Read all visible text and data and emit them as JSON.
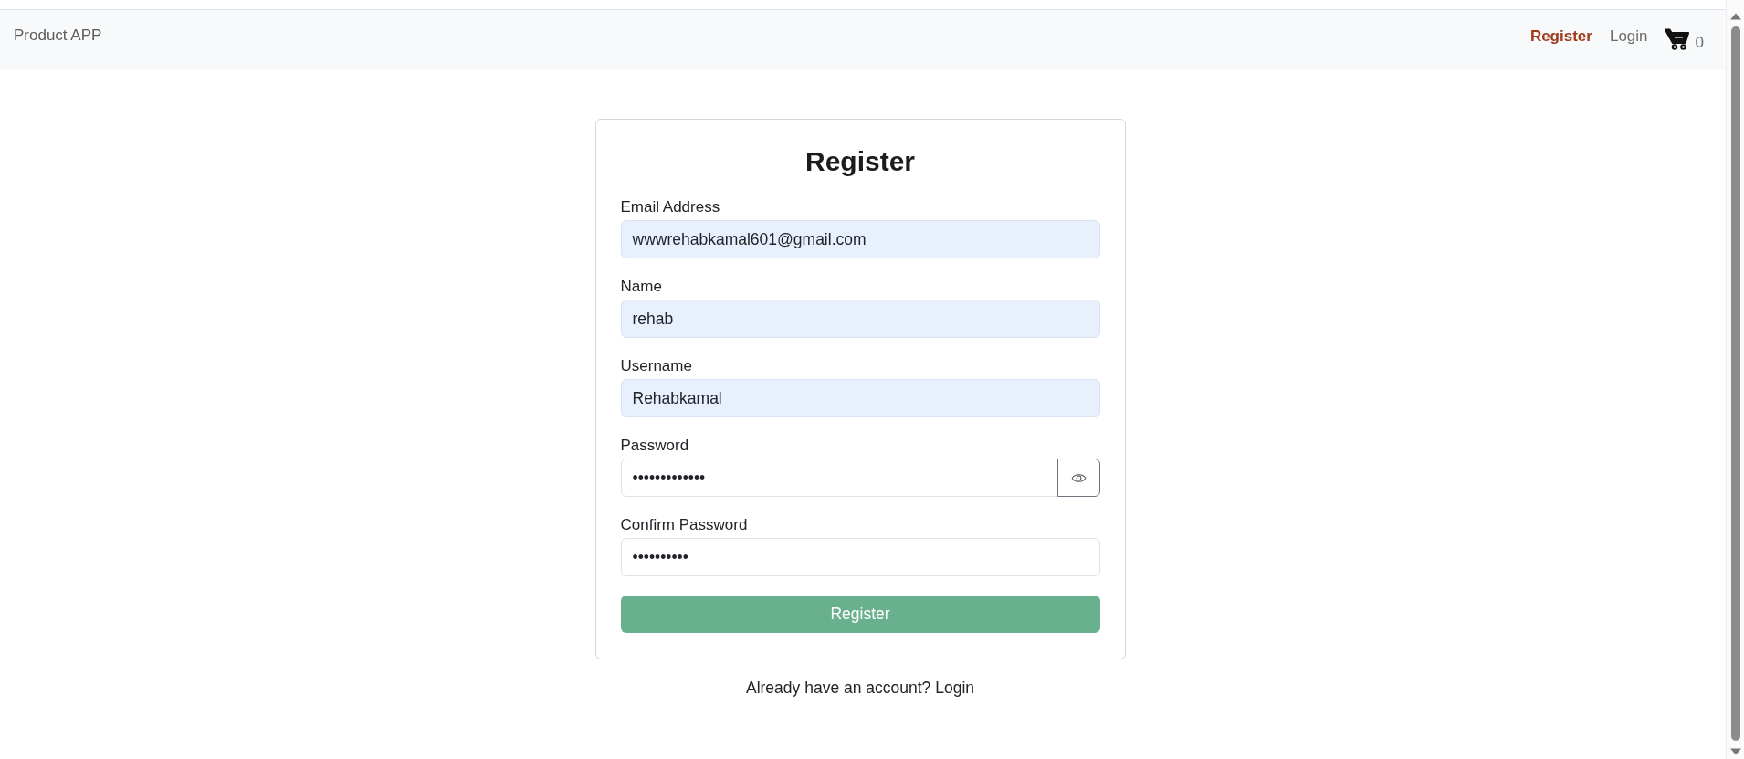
{
  "navbar": {
    "brand": "Product APP",
    "links": [
      {
        "label": "Register",
        "selected": true
      },
      {
        "label": "Login",
        "selected": false
      }
    ],
    "cart": {
      "count": "0"
    }
  },
  "form": {
    "title": "Register",
    "fields": [
      {
        "label": "Email Address",
        "value": "wwwrehabkamal601@gmail.com",
        "autofilled": true,
        "reveal_button": false
      },
      {
        "label": "Name",
        "value": "rehab",
        "autofilled": true,
        "reveal_button": false
      },
      {
        "label": "Username",
        "value": "Rehabkamal",
        "autofilled": true,
        "reveal_button": false
      },
      {
        "label": "Password",
        "value": "•••••••••••••",
        "autofilled": false,
        "reveal_button": true
      },
      {
        "label": "Confirm Password",
        "value": "••••••••••",
        "autofilled": false,
        "reveal_button": false
      }
    ],
    "submit": {
      "label": "Register",
      "disabled": true
    }
  },
  "footer": {
    "text": "Already have an account?",
    "link": "Login"
  }
}
